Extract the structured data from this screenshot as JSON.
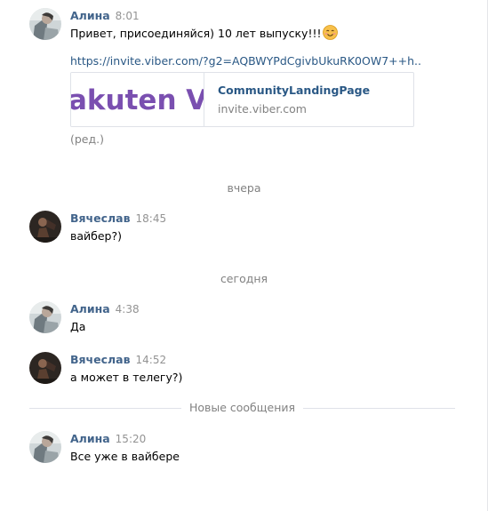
{
  "messages": [
    {
      "author": "Алина",
      "time": "8:01",
      "text": "Привет, присоединяйся) 10 лет выпуску!!!",
      "emoji": "smiling-face-emoji",
      "link": "https://invite.viber.com/?g2=AQBWYPdCgivbUkuRK0OW7++h..",
      "preview": {
        "thumb_text": "akuten Vi",
        "title": "CommunityLandingPage",
        "domain": "invite.viber.com"
      },
      "edited": "(ред.)"
    },
    {
      "author": "Вячеслав",
      "time": "18:45",
      "text": "вайбер?)"
    },
    {
      "author": "Алина",
      "time": "4:38",
      "text": "Да"
    },
    {
      "author": "Вячеслав",
      "time": "14:52",
      "text": "а может в телегу?)"
    },
    {
      "author": "Алина",
      "time": "15:20",
      "text": "Все уже в вайбере"
    }
  ],
  "separators": {
    "yesterday": "вчера",
    "today": "сегодня",
    "new_messages": "Новые сообщения"
  },
  "colors": {
    "author": "#42648b",
    "link": "#2a5885",
    "meta": "#828282",
    "viber_purple": "#7a4fb0"
  }
}
